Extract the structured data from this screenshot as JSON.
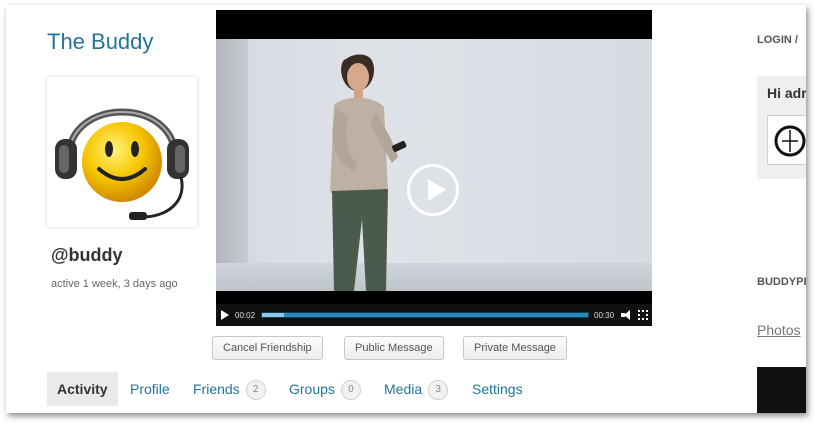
{
  "site": {
    "title": "The Buddy"
  },
  "profile": {
    "handle": "@buddy",
    "last_active": "active 1 week, 3 days ago",
    "avatar_icon": "smiley-headset-avatar"
  },
  "video": {
    "current_time": "00:02",
    "duration": "00:30",
    "progress_fraction": 0.067,
    "play_icon": "play-icon"
  },
  "actions": {
    "cancel_friendship": "Cancel Friendship",
    "public_message": "Public Message",
    "private_message": "Private Message"
  },
  "tabs": [
    {
      "label": "Activity",
      "count": null,
      "current": true
    },
    {
      "label": "Profile",
      "count": null
    },
    {
      "label": "Friends",
      "count": "2"
    },
    {
      "label": "Groups",
      "count": "0"
    },
    {
      "label": "Media",
      "count": "3"
    },
    {
      "label": "Settings",
      "count": null
    }
  ],
  "sidebar": {
    "login_heading": "LOGIN /",
    "greeting": "Hi adr",
    "buddypress_heading": "BUDDYPR",
    "photos_link": "Photos"
  },
  "colors": {
    "link": "#21759b",
    "rail": "#2a8ab8"
  }
}
